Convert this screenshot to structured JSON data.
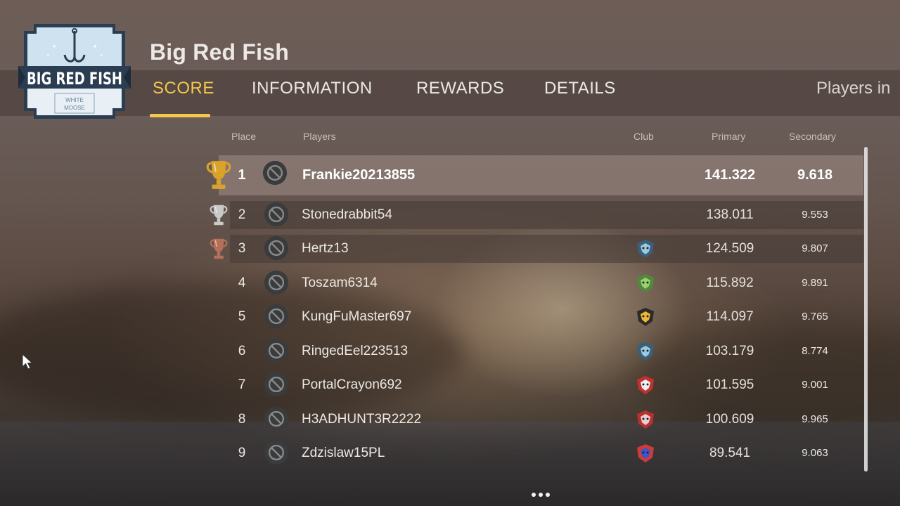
{
  "game": {
    "title": "Big Red Fish"
  },
  "logo": {
    "name": "BIG RED FISH",
    "sub1": "WHITE",
    "sub2": "MOOSE"
  },
  "tabs": [
    {
      "label": "SCORE",
      "active": true
    },
    {
      "label": "INFORMATION",
      "active": false
    },
    {
      "label": "REWARDS",
      "active": false
    },
    {
      "label": "DETAILS",
      "active": false
    }
  ],
  "players_in_label": "Players in",
  "columns": {
    "place": "Place",
    "players": "Players",
    "club": "Club",
    "primary": "Primary",
    "secondary": "Secondary"
  },
  "colors": {
    "accent": "#f2c94c",
    "gold": "#d9a22a",
    "silver": "#c9c9c9",
    "bronze": "#b5705a"
  },
  "rows": [
    {
      "place": "1",
      "name": "Frankie20213855",
      "club": "",
      "primary": "141.322",
      "secondary": "9.618",
      "trophy": "gold-trophy-icon"
    },
    {
      "place": "2",
      "name": "Stonedrabbit54",
      "club": "",
      "primary": "138.011",
      "secondary": "9.553",
      "trophy": "silver-trophy-icon"
    },
    {
      "place": "3",
      "name": "Hertz13",
      "club": "shark-club-icon",
      "primary": "124.509",
      "secondary": "9.807",
      "trophy": "bronze-trophy-icon"
    },
    {
      "place": "4",
      "name": "Toszam6314",
      "club": "green-fish-club-icon",
      "primary": "115.892",
      "secondary": "9.891",
      "trophy": ""
    },
    {
      "place": "5",
      "name": "KungFuMaster697",
      "club": "yellow-creature-club-icon",
      "primary": "114.097",
      "secondary": "9.765",
      "trophy": ""
    },
    {
      "place": "6",
      "name": "RingedEel223513",
      "club": "shark-club-icon",
      "primary": "103.179",
      "secondary": "8.774",
      "trophy": ""
    },
    {
      "place": "7",
      "name": "PortalCrayon692",
      "club": "white-shark-club-icon",
      "primary": "101.595",
      "secondary": "9.001",
      "trophy": ""
    },
    {
      "place": "8",
      "name": "H3ADHUNT3R2222",
      "club": "red-creature-club-icon",
      "primary": "100.609",
      "secondary": "9.965",
      "trophy": ""
    },
    {
      "place": "9",
      "name": "Zdzislaw15PL",
      "club": "red-blue-club-icon",
      "primary": "89.541",
      "secondary": "9.063",
      "trophy": ""
    }
  ]
}
